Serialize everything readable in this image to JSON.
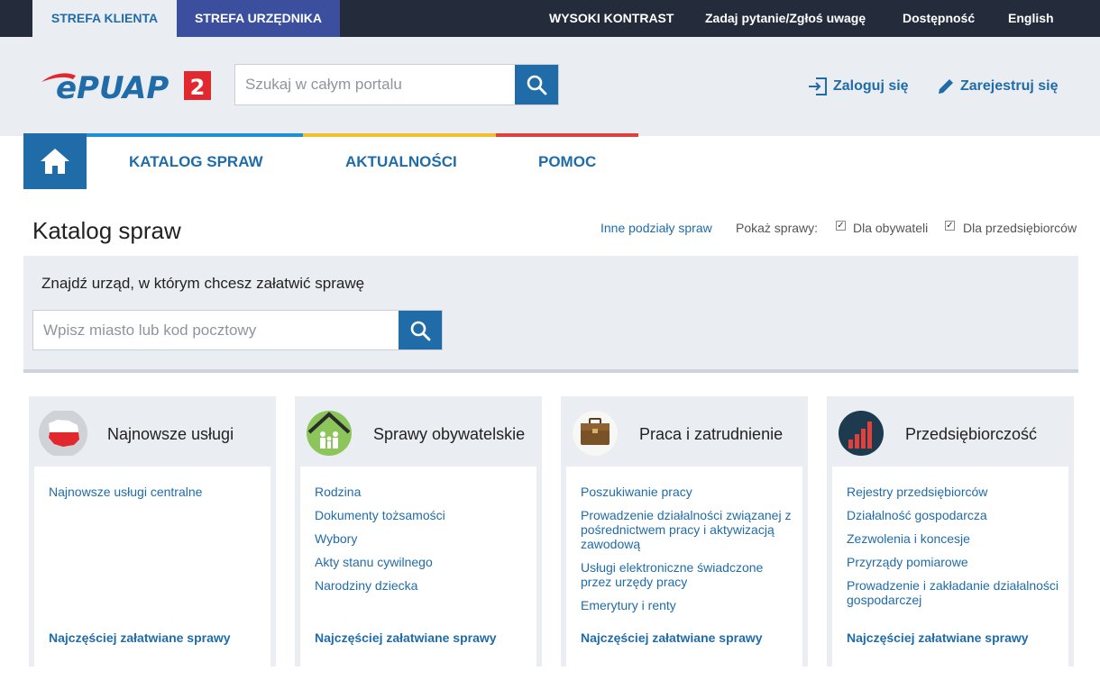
{
  "topbar": {
    "zone_client": "STREFA KLIENTA",
    "zone_officer": "STREFA URZĘDNIKA",
    "high_contrast": "WYSOKI KONTRAST",
    "ask_question": "Zadaj pytanie/Zgłoś uwagę",
    "accessibility": "Dostępność",
    "language": "English"
  },
  "header": {
    "logo_text": "ePUAP",
    "logo_badge": "2",
    "search_placeholder": "Szukaj w całym portalu",
    "login": "Zaloguj się",
    "register": "Zarejestruj się"
  },
  "nav": {
    "items": [
      "KATALOG SPRAW",
      "AKTUALNOŚCI",
      "POMOC"
    ],
    "colors": [
      "#1f8fd6",
      "#f0c030",
      "#e0413c"
    ]
  },
  "page": {
    "title": "Katalog spraw",
    "other_divisions": "Inne podziały spraw",
    "show_label": "Pokaż sprawy:",
    "for_citizens": "Dla obywateli",
    "for_business": "Dla przedsiębiorców"
  },
  "finder": {
    "title": "Znajdź urząd, w którym chcesz załatwić sprawę",
    "placeholder": "Wpisz miasto lub kod pocztowy"
  },
  "cards": [
    {
      "title": "Najnowsze usługi",
      "icon": "poland-map-icon",
      "links": [
        "Najnowsze usługi centralne"
      ],
      "footer": "Najczęściej załatwiane sprawy"
    },
    {
      "title": "Sprawy obywatelskie",
      "icon": "family-house-icon",
      "links": [
        "Rodzina",
        "Dokumenty tożsamości",
        "Wybory",
        "Akty stanu cywilnego",
        "Narodziny dziecka"
      ],
      "footer": "Najczęściej załatwiane sprawy"
    },
    {
      "title": "Praca i zatrudnienie",
      "icon": "briefcase-icon",
      "links": [
        "Poszukiwanie pracy",
        "Prowadzenie działalności związanej z pośrednictwem pracy i aktywizacją zawodową",
        "Usługi elektroniczne świadczone przez urzędy pracy",
        "Emerytury i renty"
      ],
      "footer": "Najczęściej załatwiane sprawy"
    },
    {
      "title": "Przedsiębiorczość",
      "icon": "bar-chart-icon",
      "links": [
        "Rejestry przedsiębiorców",
        "Działalność gospodarcza",
        "Zezwolenia i koncesje",
        "Przyrządy pomiarowe",
        "Prowadzenie i zakładanie działalności gospodarczej"
      ],
      "footer": "Najczęściej załatwiane sprawy"
    }
  ]
}
